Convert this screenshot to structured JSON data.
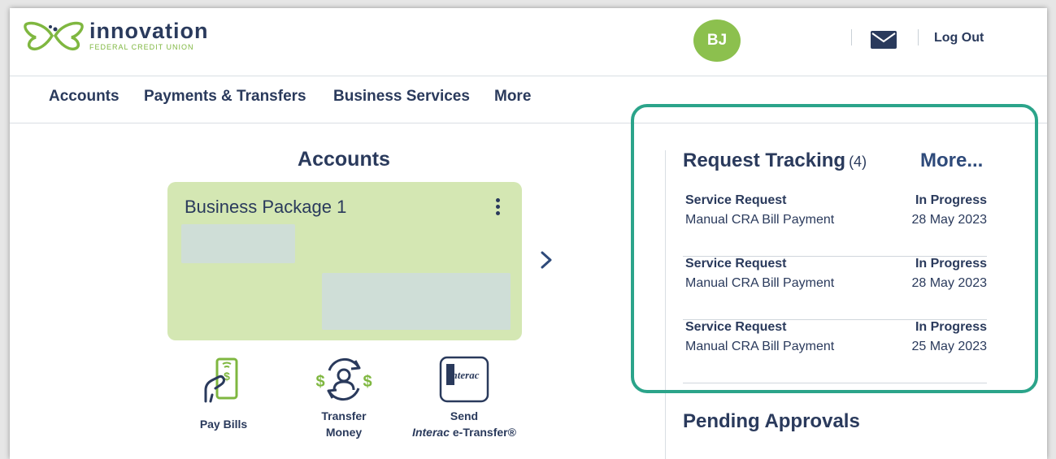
{
  "brand": {
    "name": "innovation",
    "subtitle": "FEDERAL CREDIT UNION",
    "accent": "#7fb740",
    "navy": "#2a3a5c"
  },
  "header": {
    "avatar_initials": "BJ",
    "mail_icon": "envelope-icon",
    "logout_label": "Log Out"
  },
  "nav": {
    "items": [
      "Accounts",
      "Payments & Transfers",
      "Business Services",
      "More"
    ]
  },
  "accounts": {
    "title": "Accounts",
    "card": {
      "name": "Business Package 1",
      "color": "#d4e7b3"
    },
    "actions": [
      {
        "label": "Pay Bills",
        "icon": "pay-bills-icon"
      },
      {
        "label_line1": "Transfer",
        "label_line2": "Money",
        "icon": "transfer-money-icon"
      },
      {
        "label_line1": "Send",
        "label_italic": "Interac",
        "label_rest": " e-Transfer®",
        "icon": "interac-icon",
        "logo_text": "Interac"
      }
    ]
  },
  "request_tracking": {
    "title": "Request Tracking",
    "count": "(4)",
    "more_label": "More...",
    "highlight_color": "#2ba48a",
    "rows": [
      {
        "type": "Service Request",
        "description": "Manual CRA Bill Payment",
        "status": "In Progress",
        "date": "28 May 2023"
      },
      {
        "type": "Service Request",
        "description": "Manual CRA Bill Payment",
        "status": "In Progress",
        "date": "28 May 2023"
      },
      {
        "type": "Service Request",
        "description": "Manual CRA Bill Payment",
        "status": "In Progress",
        "date": "25 May 2023"
      }
    ]
  },
  "pending_approvals": {
    "title": "Pending Approvals"
  }
}
